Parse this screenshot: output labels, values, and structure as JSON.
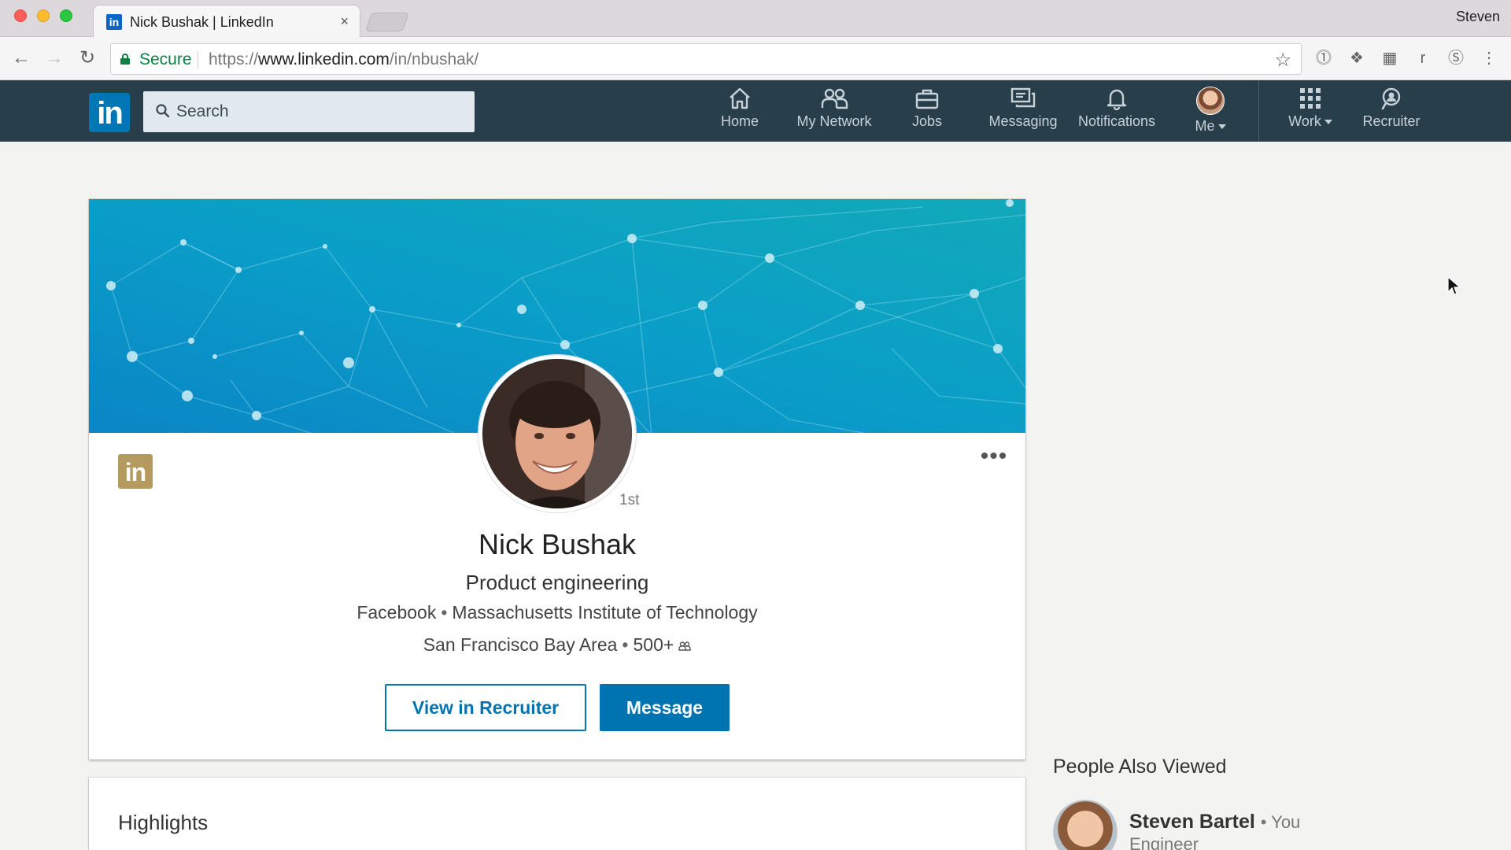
{
  "browser": {
    "tab_title": "Nick Bushak | LinkedIn",
    "tab_close": "×",
    "profile_name": "Steven",
    "secure_label": "Secure",
    "url_scheme": "https://",
    "url_host": "www.linkedin.com",
    "url_path": "/in/nbushak/",
    "extensions": [
      "1password-icon",
      "dropbox-icon",
      "extension-icon",
      "r",
      "s-icon",
      "menu-icon"
    ]
  },
  "nav": {
    "logo": "in",
    "search_placeholder": "Search",
    "items": [
      {
        "label": "Home",
        "icon": "home-icon"
      },
      {
        "label": "My Network",
        "icon": "network-icon"
      },
      {
        "label": "Jobs",
        "icon": "briefcase-icon"
      },
      {
        "label": "Messaging",
        "icon": "messaging-icon"
      },
      {
        "label": "Notifications",
        "icon": "bell-icon"
      },
      {
        "label": "Me",
        "icon": "avatar"
      },
      {
        "label": "Work",
        "icon": "grid-icon"
      },
      {
        "label": "Recruiter",
        "icon": "recruiter-icon"
      }
    ]
  },
  "profile": {
    "badge": "in",
    "more": "•••",
    "degree": "1st",
    "name": "Nick Bushak",
    "headline": "Product engineering",
    "company": "Facebook",
    "school": "Massachusetts Institute of Technology",
    "location": "San Francisco Bay Area",
    "connections": "500+",
    "bullet": "•",
    "btn_recruiter": "View in Recruiter",
    "btn_message": "Message"
  },
  "highlights": {
    "title": "Highlights"
  },
  "people_also_viewed": {
    "title": "People Also Viewed",
    "items": [
      {
        "name": "Steven Bartel",
        "you_tag": "• You",
        "subtitle": "Engineer"
      }
    ]
  },
  "colors": {
    "linkedin_nav": "#283e4a",
    "linkedin_blue": "#0073b1",
    "cover_teal": "#0399c4",
    "badge_gold": "#b59a5f"
  }
}
